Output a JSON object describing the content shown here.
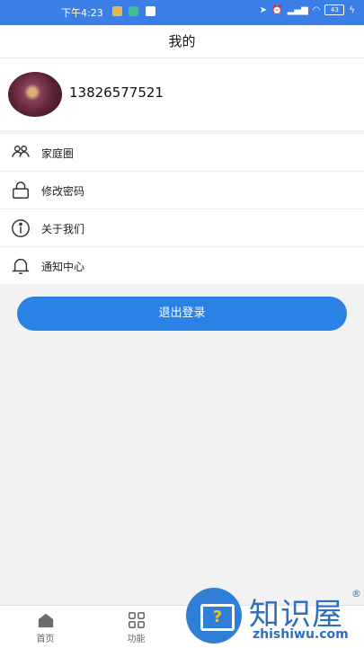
{
  "status_bar": {
    "time": "下午4:23",
    "battery": "43"
  },
  "header": {
    "title": "我的"
  },
  "profile": {
    "phone": "13826577521"
  },
  "menu": [
    {
      "label": "家庭圈",
      "icon": "family-icon"
    },
    {
      "label": "修改密码",
      "icon": "lock-icon"
    },
    {
      "label": "关于我们",
      "icon": "info-icon"
    },
    {
      "label": "通知中心",
      "icon": "bell-icon"
    }
  ],
  "logout_label": "退出登录",
  "tabs": [
    {
      "label": "首页",
      "icon": "home-icon"
    },
    {
      "label": "功能",
      "icon": "grid-icon"
    }
  ],
  "watermark": {
    "cn": "知识屋",
    "reg": "®",
    "en": "zhishiwu.com"
  },
  "colors": {
    "accent": "#2a82e4",
    "status_bar": "#3b7fe6",
    "background": "#f2f2f2"
  }
}
